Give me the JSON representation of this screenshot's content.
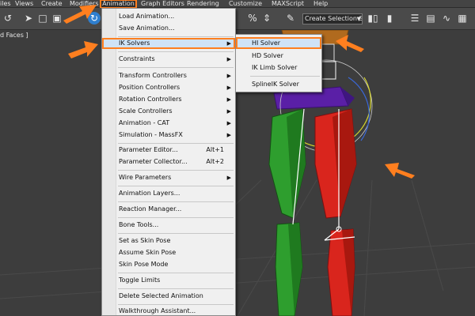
{
  "menubar": {
    "items": [
      {
        "label": "iles"
      },
      {
        "label": "Views"
      },
      {
        "label": "Create"
      },
      {
        "label": "Modifiers"
      },
      {
        "label": "Animation"
      },
      {
        "label": "Graph Editors"
      },
      {
        "label": "Rendering"
      },
      {
        "label": "Customize"
      },
      {
        "label": "MAXScript"
      },
      {
        "label": "Help"
      }
    ],
    "active": "Animation"
  },
  "toolbar": {
    "selection_set_value": "Create Selection Se",
    "percent_snap_icon": "%",
    "icons": [
      "undo-icon",
      "select-icon",
      "region-select-icon",
      "window-crossing-icon",
      "rotate-icon",
      "snap-icon",
      "angle-snap-icon",
      "percent-snap-icon",
      "spinner-snap-icon",
      "edit-named-selection-icon",
      "mirror-icon",
      "align-icon",
      "layer-manager-icon",
      "graphite-ribbon-icon",
      "curve-editor-icon",
      "schematic-view-icon",
      "material-editor-icon"
    ]
  },
  "viewport": {
    "label": "d Faces ]"
  },
  "animation_menu": {
    "items": [
      {
        "label": "Load Animation...",
        "shortcut": "",
        "submenu": false
      },
      {
        "label": "Save Animation...",
        "shortcut": "",
        "submenu": false
      },
      {
        "label": "IK Solvers",
        "shortcut": "",
        "submenu": true
      },
      {
        "label": "Constraints",
        "shortcut": "",
        "submenu": true
      },
      {
        "label": "Transform Controllers",
        "shortcut": "",
        "submenu": true
      },
      {
        "label": "Position Controllers",
        "shortcut": "",
        "submenu": true
      },
      {
        "label": "Rotation Controllers",
        "shortcut": "",
        "submenu": true
      },
      {
        "label": "Scale Controllers",
        "shortcut": "",
        "submenu": true
      },
      {
        "label": "Animation - CAT",
        "shortcut": "",
        "submenu": true
      },
      {
        "label": "Simulation - MassFX",
        "shortcut": "",
        "submenu": true
      },
      {
        "label": "Parameter Editor...",
        "shortcut": "Alt+1",
        "submenu": false
      },
      {
        "label": "Parameter Collector...",
        "shortcut": "Alt+2",
        "submenu": false
      },
      {
        "label": "Wire Parameters",
        "shortcut": "",
        "submenu": true
      },
      {
        "label": "Animation Layers...",
        "shortcut": "",
        "submenu": false
      },
      {
        "label": "Reaction Manager...",
        "shortcut": "",
        "submenu": false
      },
      {
        "label": "Bone Tools...",
        "shortcut": "",
        "submenu": false
      },
      {
        "label": "Set as Skin Pose",
        "shortcut": "",
        "submenu": false
      },
      {
        "label": "Assume Skin Pose",
        "shortcut": "",
        "submenu": false
      },
      {
        "label": "Skin Pose Mode",
        "shortcut": "",
        "submenu": false
      },
      {
        "label": "Toggle Limits",
        "shortcut": "",
        "submenu": false
      },
      {
        "label": "Delete Selected Animation",
        "shortcut": "",
        "submenu": false
      },
      {
        "label": "Walkthrough Assistant...",
        "shortcut": "",
        "submenu": false
      }
    ],
    "highlighted": "IK Solvers"
  },
  "ik_submenu": {
    "items": [
      {
        "label": "HI Solver"
      },
      {
        "label": "HD Solver"
      },
      {
        "label": "IK Limb Solver"
      },
      {
        "label": "SplineIK Solver"
      }
    ],
    "highlighted": "HI Solver"
  },
  "colors": {
    "annotation_arrow": "#ff7f1f",
    "left_leg": "#2e9e2e",
    "right_leg": "#d9251d",
    "pelvis": "#5a1fa6",
    "menu_highlight": "#cfe3f7"
  }
}
